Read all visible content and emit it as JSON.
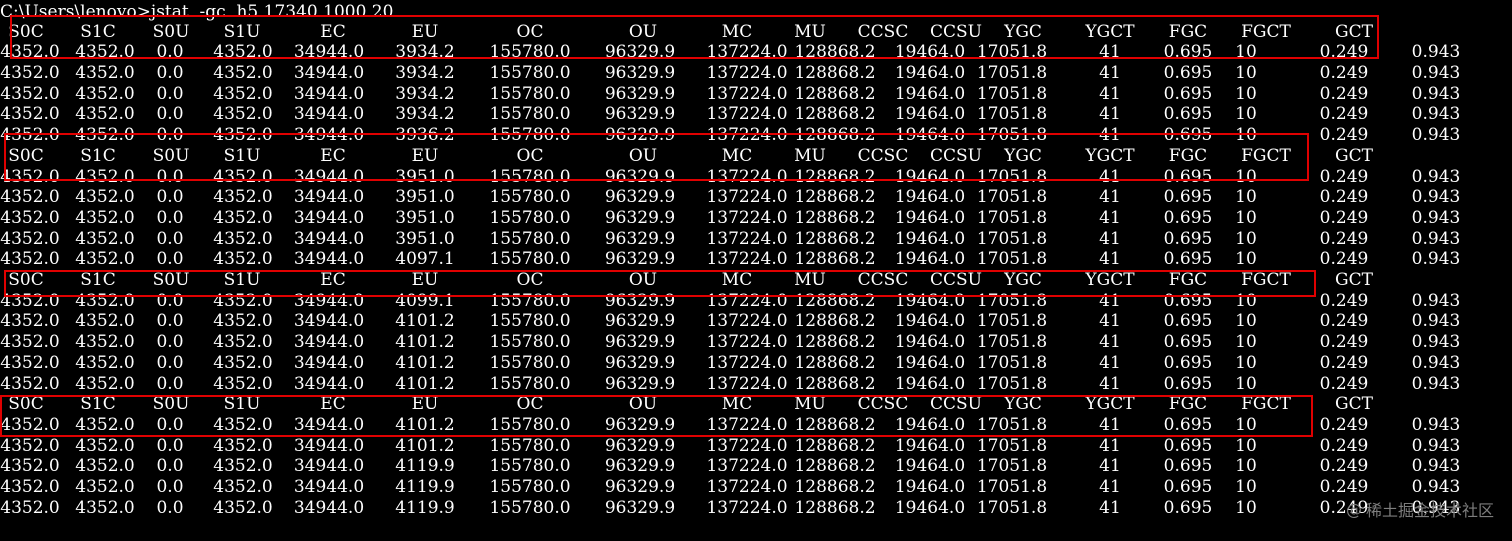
{
  "terminal": {
    "background": "#000000",
    "foreground": "#ffffff",
    "accent_color": "#e00000",
    "command_line": "C:\\Users\\lenovo>jstat  -gc  h5 17340 1000 20",
    "columns": [
      "S0C",
      "S1C",
      "S0U",
      "S1U",
      "EC",
      "EU",
      "OC",
      "OU",
      "MC",
      "MU",
      "CCSC",
      "CCSU",
      "YGC",
      "YGCT",
      "FGC",
      "FGCT",
      "GCT"
    ],
    "rows": [
      {
        "type": "header",
        "cells": [
          "S0C",
          "S1C",
          "S0U",
          "S1U",
          "EC",
          "EU",
          "OC",
          "OU",
          "MC",
          "MU",
          "CCSC",
          "CCSU",
          "YGC",
          "YGCT",
          "FGC",
          "FGCT",
          "GCT"
        ]
      },
      {
        "type": "data",
        "cells": [
          "4352.0",
          "4352.0",
          "0.0",
          "4352.0",
          "34944.0",
          "3934.2",
          "155780.0",
          "96329.9",
          "137224.0",
          "128868.2",
          "19464.0",
          "17051.8",
          "41",
          "0.695",
          "10",
          "0.249",
          "0.943"
        ]
      },
      {
        "type": "data",
        "cells": [
          "4352.0",
          "4352.0",
          "0.0",
          "4352.0",
          "34944.0",
          "3934.2",
          "155780.0",
          "96329.9",
          "137224.0",
          "128868.2",
          "19464.0",
          "17051.8",
          "41",
          "0.695",
          "10",
          "0.249",
          "0.943"
        ]
      },
      {
        "type": "data",
        "cells": [
          "4352.0",
          "4352.0",
          "0.0",
          "4352.0",
          "34944.0",
          "3934.2",
          "155780.0",
          "96329.9",
          "137224.0",
          "128868.2",
          "19464.0",
          "17051.8",
          "41",
          "0.695",
          "10",
          "0.249",
          "0.943"
        ]
      },
      {
        "type": "data",
        "cells": [
          "4352.0",
          "4352.0",
          "0.0",
          "4352.0",
          "34944.0",
          "3934.2",
          "155780.0",
          "96329.9",
          "137224.0",
          "128868.2",
          "19464.0",
          "17051.8",
          "41",
          "0.695",
          "10",
          "0.249",
          "0.943"
        ]
      },
      {
        "type": "data",
        "cells": [
          "4352.0",
          "4352.0",
          "0.0",
          "4352.0",
          "34944.0",
          "3936.2",
          "155780.0",
          "96329.9",
          "137224.0",
          "128868.2",
          "19464.0",
          "17051.8",
          "41",
          "0.695",
          "10",
          "0.249",
          "0.943"
        ]
      },
      {
        "type": "header",
        "cells": [
          "S0C",
          "S1C",
          "S0U",
          "S1U",
          "EC",
          "EU",
          "OC",
          "OU",
          "MC",
          "MU",
          "CCSC",
          "CCSU",
          "YGC",
          "YGCT",
          "FGC",
          "FGCT",
          "GCT"
        ]
      },
      {
        "type": "data",
        "cells": [
          "4352.0",
          "4352.0",
          "0.0",
          "4352.0",
          "34944.0",
          "3951.0",
          "155780.0",
          "96329.9",
          "137224.0",
          "128868.2",
          "19464.0",
          "17051.8",
          "41",
          "0.695",
          "10",
          "0.249",
          "0.943"
        ]
      },
      {
        "type": "data",
        "cells": [
          "4352.0",
          "4352.0",
          "0.0",
          "4352.0",
          "34944.0",
          "3951.0",
          "155780.0",
          "96329.9",
          "137224.0",
          "128868.2",
          "19464.0",
          "17051.8",
          "41",
          "0.695",
          "10",
          "0.249",
          "0.943"
        ]
      },
      {
        "type": "data",
        "cells": [
          "4352.0",
          "4352.0",
          "0.0",
          "4352.0",
          "34944.0",
          "3951.0",
          "155780.0",
          "96329.9",
          "137224.0",
          "128868.2",
          "19464.0",
          "17051.8",
          "41",
          "0.695",
          "10",
          "0.249",
          "0.943"
        ]
      },
      {
        "type": "data",
        "cells": [
          "4352.0",
          "4352.0",
          "0.0",
          "4352.0",
          "34944.0",
          "3951.0",
          "155780.0",
          "96329.9",
          "137224.0",
          "128868.2",
          "19464.0",
          "17051.8",
          "41",
          "0.695",
          "10",
          "0.249",
          "0.943"
        ]
      },
      {
        "type": "data",
        "cells": [
          "4352.0",
          "4352.0",
          "0.0",
          "4352.0",
          "34944.0",
          "4097.1",
          "155780.0",
          "96329.9",
          "137224.0",
          "128868.2",
          "19464.0",
          "17051.8",
          "41",
          "0.695",
          "10",
          "0.249",
          "0.943"
        ]
      },
      {
        "type": "header",
        "cells": [
          "S0C",
          "S1C",
          "S0U",
          "S1U",
          "EC",
          "EU",
          "OC",
          "OU",
          "MC",
          "MU",
          "CCSC",
          "CCSU",
          "YGC",
          "YGCT",
          "FGC",
          "FGCT",
          "GCT"
        ]
      },
      {
        "type": "data",
        "cells": [
          "4352.0",
          "4352.0",
          "0.0",
          "4352.0",
          "34944.0",
          "4099.1",
          "155780.0",
          "96329.9",
          "137224.0",
          "128868.2",
          "19464.0",
          "17051.8",
          "41",
          "0.695",
          "10",
          "0.249",
          "0.943"
        ]
      },
      {
        "type": "data",
        "cells": [
          "4352.0",
          "4352.0",
          "0.0",
          "4352.0",
          "34944.0",
          "4101.2",
          "155780.0",
          "96329.9",
          "137224.0",
          "128868.2",
          "19464.0",
          "17051.8",
          "41",
          "0.695",
          "10",
          "0.249",
          "0.943"
        ]
      },
      {
        "type": "data",
        "cells": [
          "4352.0",
          "4352.0",
          "0.0",
          "4352.0",
          "34944.0",
          "4101.2",
          "155780.0",
          "96329.9",
          "137224.0",
          "128868.2",
          "19464.0",
          "17051.8",
          "41",
          "0.695",
          "10",
          "0.249",
          "0.943"
        ]
      },
      {
        "type": "data",
        "cells": [
          "4352.0",
          "4352.0",
          "0.0",
          "4352.0",
          "34944.0",
          "4101.2",
          "155780.0",
          "96329.9",
          "137224.0",
          "128868.2",
          "19464.0",
          "17051.8",
          "41",
          "0.695",
          "10",
          "0.249",
          "0.943"
        ]
      },
      {
        "type": "data",
        "cells": [
          "4352.0",
          "4352.0",
          "0.0",
          "4352.0",
          "34944.0",
          "4101.2",
          "155780.0",
          "96329.9",
          "137224.0",
          "128868.2",
          "19464.0",
          "17051.8",
          "41",
          "0.695",
          "10",
          "0.249",
          "0.943"
        ]
      },
      {
        "type": "header",
        "cells": [
          "S0C",
          "S1C",
          "S0U",
          "S1U",
          "EC",
          "EU",
          "OC",
          "OU",
          "MC",
          "MU",
          "CCSC",
          "CCSU",
          "YGC",
          "YGCT",
          "FGC",
          "FGCT",
          "GCT"
        ]
      },
      {
        "type": "data",
        "cells": [
          "4352.0",
          "4352.0",
          "0.0",
          "4352.0",
          "34944.0",
          "4101.2",
          "155780.0",
          "96329.9",
          "137224.0",
          "128868.2",
          "19464.0",
          "17051.8",
          "41",
          "0.695",
          "10",
          "0.249",
          "0.943"
        ]
      },
      {
        "type": "data",
        "cells": [
          "4352.0",
          "4352.0",
          "0.0",
          "4352.0",
          "34944.0",
          "4101.2",
          "155780.0",
          "96329.9",
          "137224.0",
          "128868.2",
          "19464.0",
          "17051.8",
          "41",
          "0.695",
          "10",
          "0.249",
          "0.943"
        ]
      },
      {
        "type": "data",
        "cells": [
          "4352.0",
          "4352.0",
          "0.0",
          "4352.0",
          "34944.0",
          "4119.9",
          "155780.0",
          "96329.9",
          "137224.0",
          "128868.2",
          "19464.0",
          "17051.8",
          "41",
          "0.695",
          "10",
          "0.249",
          "0.943"
        ]
      },
      {
        "type": "data",
        "cells": [
          "4352.0",
          "4352.0",
          "0.0",
          "4352.0",
          "34944.0",
          "4119.9",
          "155780.0",
          "96329.9",
          "137224.0",
          "128868.2",
          "19464.0",
          "17051.8",
          "41",
          "0.695",
          "10",
          "0.249",
          "0.943"
        ]
      },
      {
        "type": "data",
        "cells": [
          "4352.0",
          "4352.0",
          "0.0",
          "4352.0",
          "34944.0",
          "4119.9",
          "155780.0",
          "96329.9",
          "137224.0",
          "128868.2",
          "19464.0",
          "17051.8",
          "41",
          "0.695",
          "10",
          "0.249",
          "0.943"
        ]
      }
    ],
    "watermark": {
      "icon": "at-sign-icon",
      "text": "稀土掘金技术社区"
    }
  }
}
